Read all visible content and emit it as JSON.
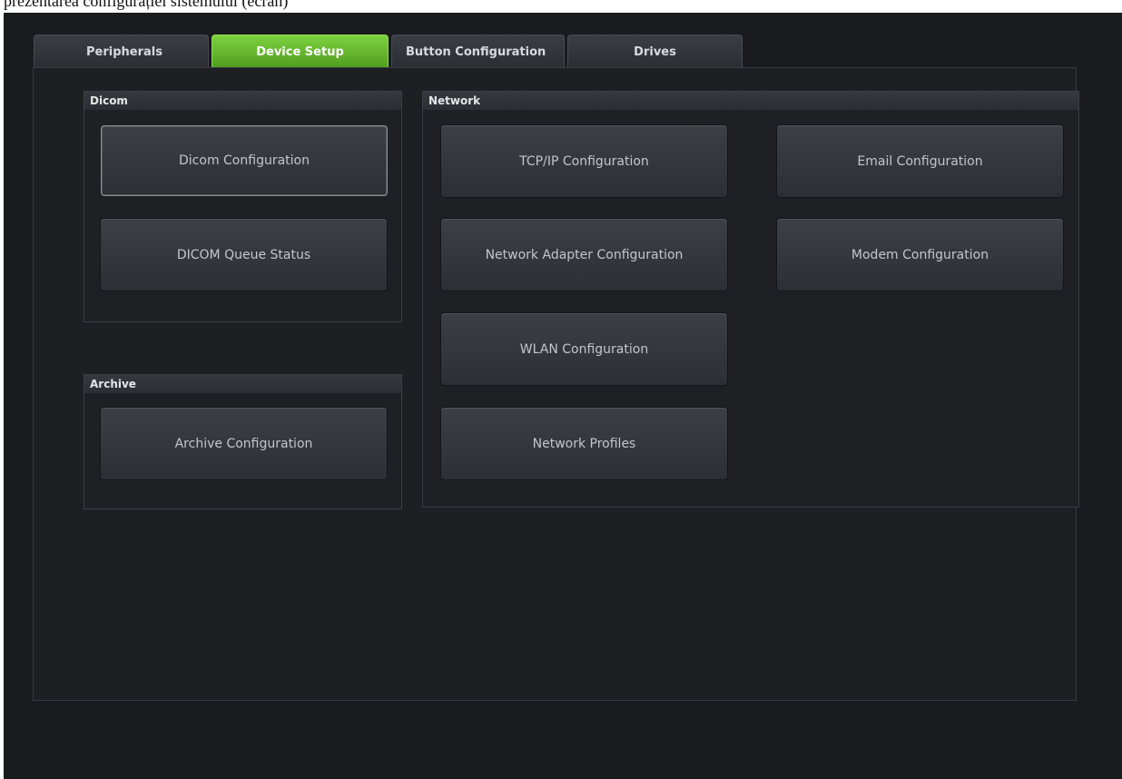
{
  "caption": "prezentarea configurației sistemului (ecran)",
  "tabs": [
    {
      "label": "Peripherals",
      "active": false
    },
    {
      "label": "Device Setup",
      "active": true
    },
    {
      "label": "Button Configuration",
      "active": false
    },
    {
      "label": "Drives",
      "active": false
    }
  ],
  "dicom": {
    "title": "Dicom",
    "buttons": [
      "Dicom Configuration",
      "DICOM Queue Status"
    ]
  },
  "archive": {
    "title": "Archive",
    "buttons": [
      "Archive Configuration"
    ]
  },
  "network": {
    "title": "Network",
    "buttons": [
      "TCP/IP Configuration",
      "Email Configuration",
      "Network Adapter Configuration",
      "Modem Configuration",
      "WLAN Configuration",
      "Network Profiles"
    ]
  },
  "colors": {
    "active_tab": "#5fb02a",
    "background": "#191b1e",
    "button_face": "#34373c"
  }
}
